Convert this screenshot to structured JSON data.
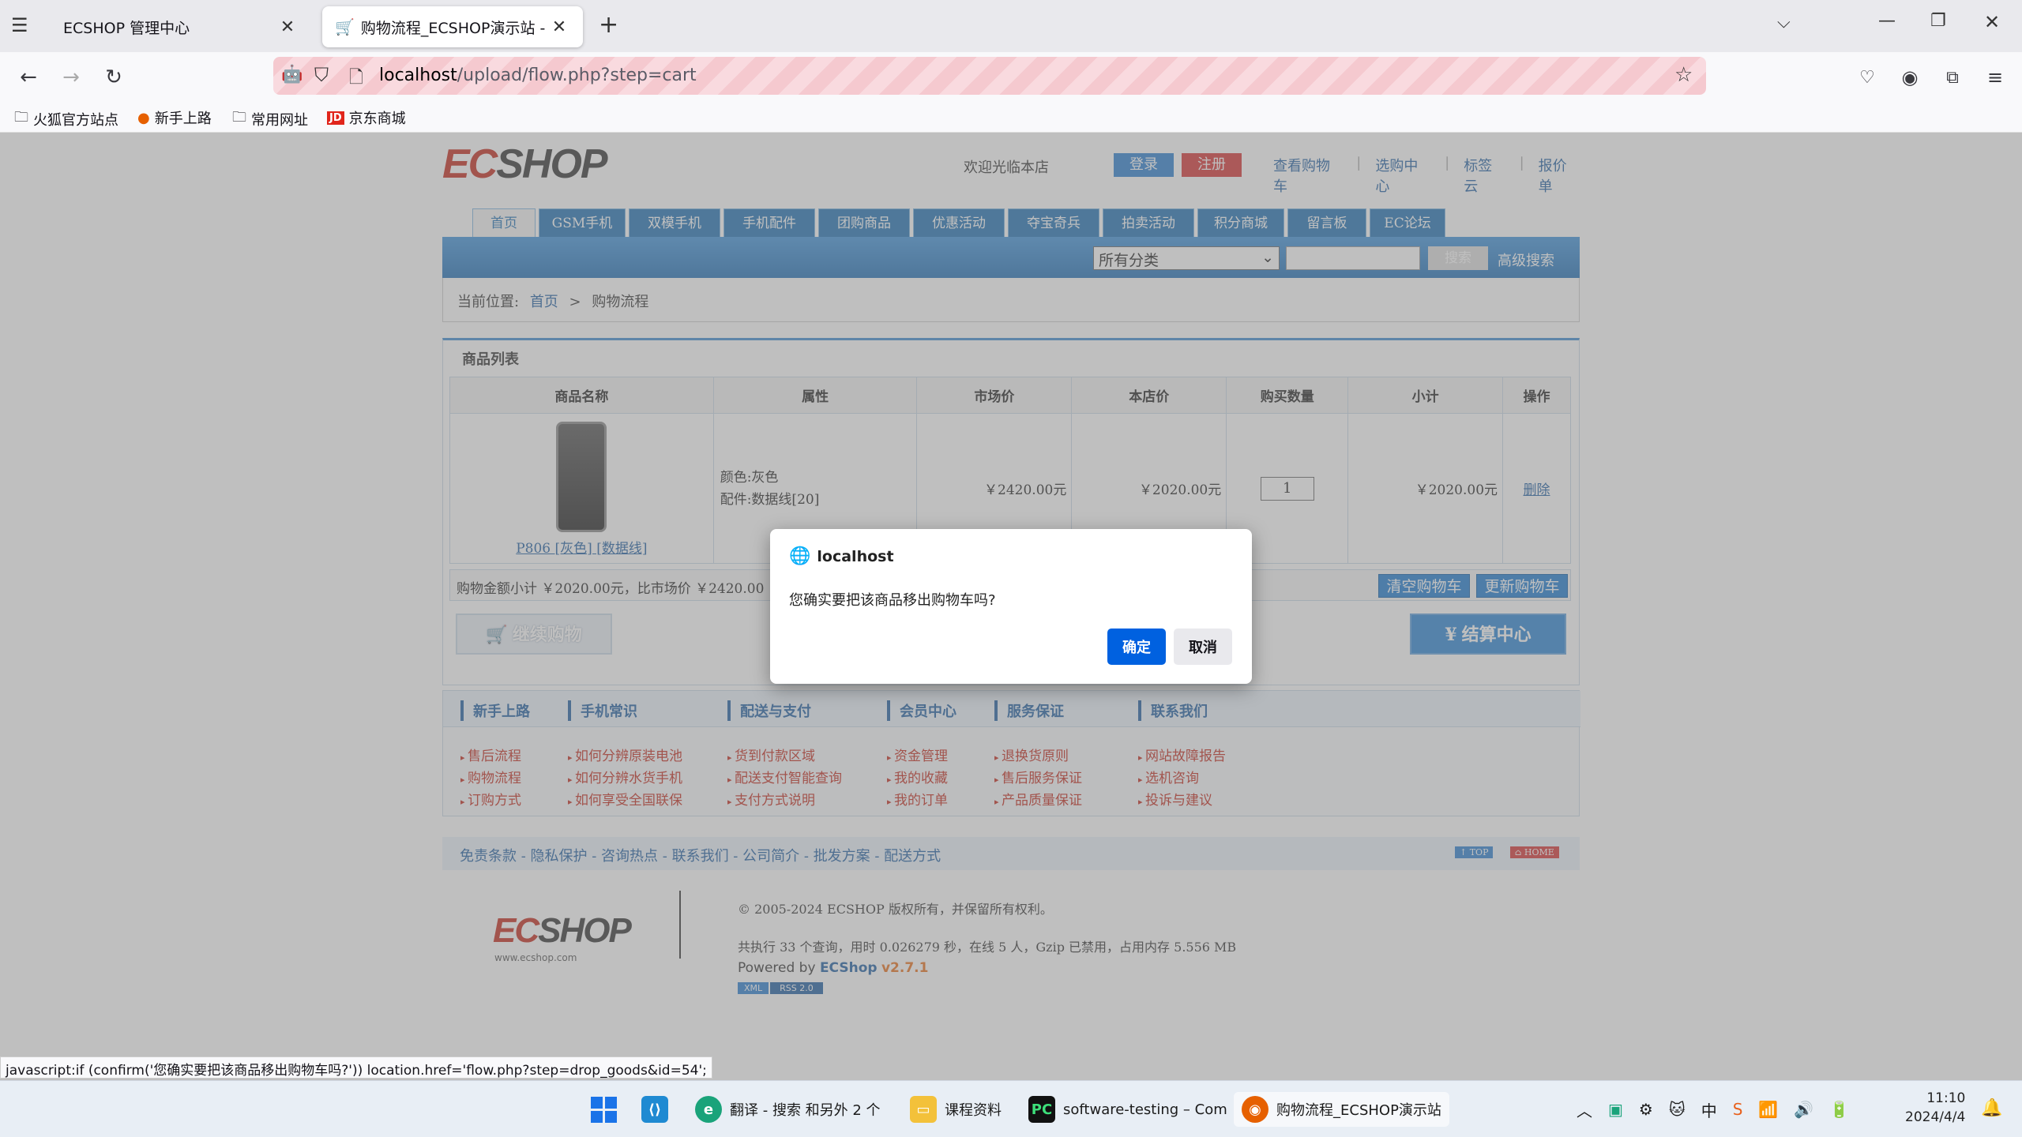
{
  "browser": {
    "tabs": [
      {
        "title": "ECSHOP 管理中心"
      },
      {
        "title": "购物流程_ECSHOP演示站 - Po"
      }
    ],
    "url_host": "localhost",
    "url_path": "/upload/flow.php?step=cart",
    "bookmarks": [
      "火狐官方站点",
      "新手上路",
      "常用网址",
      "京东商城"
    ]
  },
  "shop": {
    "logo": "ECSHOP",
    "welcome": "欢迎光临本店",
    "login_label": "登录",
    "register_label": "注册",
    "top_links": [
      "查看购物车",
      "选购中心",
      "标签云",
      "报价单"
    ],
    "nav": [
      "首页",
      "GSM手机",
      "双模手机",
      "手机配件",
      "团购商品",
      "优惠活动",
      "夺宝奇兵",
      "拍卖活动",
      "积分商城",
      "留言板",
      "EC论坛"
    ],
    "category_select": "所有分类",
    "search_button": "搜索",
    "advanced_search": "高级搜索",
    "breadcrumb": {
      "prefix": "当前位置:",
      "home": "首页",
      "sep": ">",
      "current": "购物流程"
    },
    "cart_title": "商品列表",
    "cart_headers": [
      "商品名称",
      "属性",
      "市场价",
      "本店价",
      "购买数量",
      "小计",
      "操作"
    ],
    "cart_item": {
      "name": "P806 [灰色] [数据线]",
      "attr_color": "颜色:灰色",
      "attr_accessory": "配件:数据线[20]",
      "market_price": "￥2420.00元",
      "shop_price": "￥2020.00元",
      "quantity": "1",
      "subtotal": "￥2020.00元",
      "delete_label": "删除"
    },
    "summary": "购物金额小计 ￥2020.00元，比市场价 ￥2420.00",
    "clear_cart": "清空购物车",
    "update_cart": "更新购物车",
    "continue_shopping": "继续购物",
    "checkout": "结算中心",
    "help": [
      {
        "title": "新手上路",
        "items": [
          "售后流程",
          "购物流程",
          "订购方式"
        ]
      },
      {
        "title": "手机常识",
        "items": [
          "如何分辨原装电池",
          "如何分辨水货手机",
          "如何享受全国联保"
        ]
      },
      {
        "title": "配送与支付",
        "items": [
          "货到付款区域",
          "配送支付智能查询",
          "支付方式说明"
        ]
      },
      {
        "title": "会员中心",
        "items": [
          "资金管理",
          "我的收藏",
          "我的订单"
        ]
      },
      {
        "title": "服务保证",
        "items": [
          "退换货原则",
          "售后服务保证",
          "产品质量保证"
        ]
      },
      {
        "title": "联系我们",
        "items": [
          "网站故障报告",
          "选机咨询",
          "投诉与建议"
        ]
      }
    ],
    "footer_links": "免责条款 - 隐私保护 - 咨询热点 - 联系我们 - 公司简介 - 批发方案 - 配送方式",
    "top_badge": "TOP",
    "home_badge": "HOME",
    "copyright": "© 2005-2024 ECSHOP 版权所有，并保留所有权利。",
    "stats": "共执行 33 个查询，用时 0.026279 秒，在线 5 人，Gzip 已禁用，占用内存 5.556 MB",
    "powered_prefix": "Powered by",
    "powered_brand": "ECShop",
    "powered_version": "v2.7.1",
    "footer_logo_url": "www.ecshop.com",
    "xml_badge": "XML",
    "rss_badge": "RSS 2.0"
  },
  "dialog": {
    "origin": "localhost",
    "message": "您确实要把该商品移出购物车吗?",
    "ok": "确定",
    "cancel": "取消"
  },
  "status_bar": "javascript:if (confirm('您确实要把该商品移出购物车吗?')) location.href='flow.php?step=drop_goods&id=54';",
  "taskbar": {
    "items": [
      "翻译 - 搜索 和另外 2 个",
      "课程资料",
      "software-testing – Com",
      "购物流程_ECSHOP演示站"
    ],
    "time": "11:10",
    "date": "2024/4/4"
  },
  "colors": {
    "accent": "#1e71b4",
    "dialog_ok": "#0061e0",
    "url_stripe": "#f5c9cf"
  }
}
